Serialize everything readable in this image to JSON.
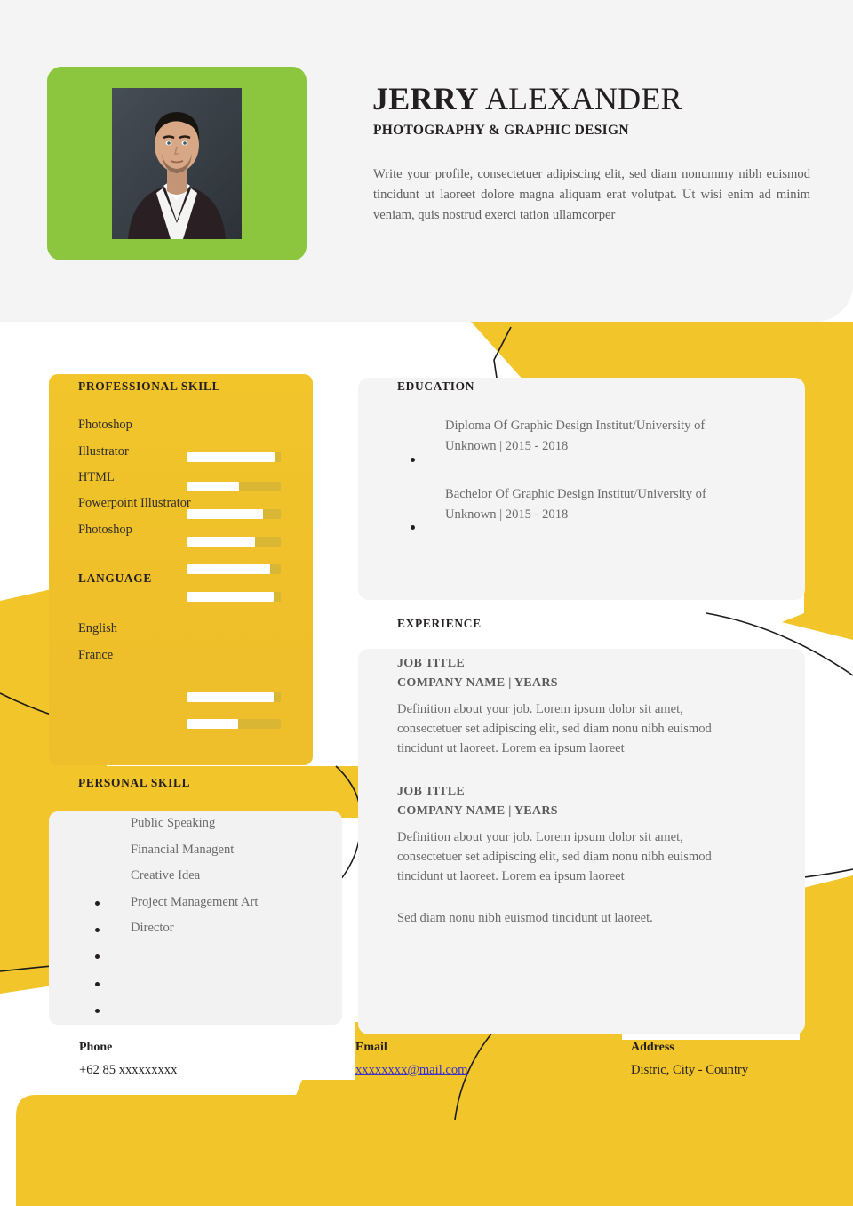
{
  "colors": {
    "yellow": "#f2c52b",
    "yellow_dark": "#e8b81f",
    "green": "#8cc63f",
    "panel_gray": "#f4f4f4",
    "bar_track": "#d9b734",
    "bar_fill": "#ffffff",
    "text_dark": "#231f20",
    "text_muted": "#6a6a6a",
    "link_blue": "#3a31c4"
  },
  "header": {
    "name_first": "JERRY",
    "name_last": "ALEXANDER",
    "role": "PHOTOGRAPHY & GRAPHIC DESIGN",
    "profile": "Write your profile, consectetuer adipiscing elit, sed diam nonummy nibh euismod tincidunt ut laoreet dolore magna aliquam erat volutpat. Ut wisi enim ad minim veniam, quis nostrud exerci tation ullamcorper"
  },
  "professional_skill": {
    "title": "PROFESSIONAL SKILL",
    "items": [
      {
        "label": "Photoshop",
        "value": 93
      },
      {
        "label": "Illustrator",
        "value": 55
      },
      {
        "label": "HTML",
        "value": 81
      },
      {
        "label": "Powerpoint Illustrator",
        "value": 72
      },
      {
        "label": "Photoshop",
        "value": 89
      }
    ]
  },
  "language": {
    "title": "LANGUAGE",
    "items": [
      {
        "label": "English",
        "value": 92
      },
      {
        "label": "France",
        "value": 54
      }
    ],
    "extra_bars": [
      {
        "value": 92
      },
      {
        "value": 54
      }
    ]
  },
  "personal_skill": {
    "title": "PERSONAL SKILL",
    "items": [
      "Public Speaking",
      "Financial Managent",
      "Creative Idea",
      "Project Management Art",
      "Director"
    ],
    "bullet_count": 5
  },
  "education": {
    "title": "EDUCATION",
    "entries": [
      "Diploma Of Graphic Design Institut/University of Unknown | 2015 - 2018",
      "Bachelor Of Graphic Design Institut/University of Unknown | 2015 - 2018"
    ]
  },
  "experience": {
    "title": "EXPERIENCE",
    "jobs": [
      {
        "title": "JOB TITLE",
        "company": "COMPANY NAME | YEARS",
        "description": "Definition about your job. Lorem ipsum dolor sit amet, consectetuer set adipiscing elit, sed diam nonu nibh euismod tincidunt ut laoreet. Lorem ea ipsum laoreet"
      },
      {
        "title": "JOB TITLE",
        "company": "COMPANY NAME | YEARS",
        "description": "Definition about your job. Lorem ipsum dolor sit amet, consectetuer set adipiscing elit, sed diam nonu nibh euismod tincidunt ut laoreet. Lorem ea ipsum laoreet"
      }
    ],
    "note": "Sed diam nonu nibh euismod tincidunt ut laoreet."
  },
  "contact": {
    "phone_label": "Phone",
    "phone_value": "+62 85 xxxxxxxxx",
    "email_label": "Email",
    "email_value": "xxxxxxxx@mail.com",
    "address_label": "Address",
    "address_value": "Distric, City - Country"
  }
}
